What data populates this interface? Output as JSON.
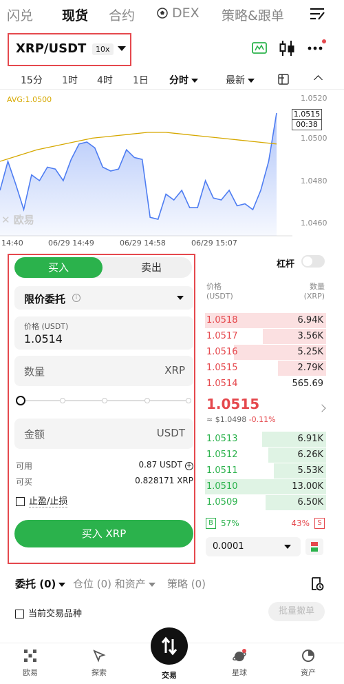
{
  "topnav": {
    "items": [
      "闪兑",
      "现货",
      "合约",
      "DEX",
      "策略&跟单"
    ],
    "active_index": 1
  },
  "pair": {
    "name": "XRP/USDT",
    "leverage": "10x"
  },
  "intervals": {
    "items": [
      "15分",
      "1时",
      "4时",
      "1日"
    ],
    "mode": "分时",
    "sort": "最新"
  },
  "chart": {
    "avg_label": "AVG:1.0500",
    "current_price": "1.0515",
    "countdown": "00:38",
    "watermark": "欧易"
  },
  "chart_data": {
    "type": "line",
    "x_labels": [
      "14:40",
      "06/29 14:49",
      "06/29 14:58",
      "06/29 15:07"
    ],
    "y_ticks": [
      "1.0520",
      "1.0500",
      "1.0480",
      "1.0460"
    ],
    "ylim": [
      1.0455,
      1.0525
    ],
    "series": [
      {
        "values": [
          1.0475,
          1.049,
          1.0478,
          1.0465,
          1.0483,
          1.048,
          1.0487,
          1.0486,
          1.048,
          1.0491,
          1.0499,
          1.05,
          1.0497,
          1.0487,
          1.0485,
          1.0486,
          1.0496,
          1.0492,
          1.0491,
          1.0461,
          1.046,
          1.0473,
          1.047,
          1.0475,
          1.0466,
          1.0466,
          1.048,
          1.0471,
          1.047,
          1.0475,
          1.0467,
          1.0468,
          1.0465,
          1.0475,
          1.049,
          1.0515
        ]
      },
      {
        "values": [
          1.049,
          1.0493,
          1.0496,
          1.0498,
          1.05,
          1.0502,
          1.0503,
          1.0504,
          1.0505,
          1.0505,
          1.0504,
          1.0503,
          1.0502,
          1.0501,
          1.05,
          1.0499
        ]
      }
    ]
  },
  "trade": {
    "tab_buy": "买入",
    "tab_sell": "卖出",
    "order_type": "限价委托",
    "price_caption": "价格 (USDT)",
    "price_value": "1.0514",
    "qty_placeholder": "数量",
    "qty_unit": "XRP",
    "amount_placeholder": "金额",
    "amount_unit": "USDT",
    "available_label": "可用",
    "available_value": "0.87 USDT",
    "can_buy_label": "可买",
    "can_buy_value": "0.828171 XRP",
    "tpsl_label": "止盈/止损",
    "buy_button": "买入 XRP"
  },
  "orderbook": {
    "leverage_label": "杠杆",
    "price_header": "价格",
    "price_header_unit": "(USDT)",
    "qty_header": "数量",
    "qty_header_unit": "(XRP)",
    "asks": [
      {
        "price": "1.0518",
        "qty": "6.94K",
        "depth": 1.0
      },
      {
        "price": "1.0517",
        "qty": "3.56K",
        "depth": 0.52
      },
      {
        "price": "1.0516",
        "qty": "5.25K",
        "depth": 0.76
      },
      {
        "price": "1.0515",
        "qty": "2.79K",
        "depth": 0.4
      },
      {
        "price": "1.0514",
        "qty": "565.69",
        "depth": 0.0
      }
    ],
    "last_price": "1.0515",
    "last_usd": "≈ $1.0498",
    "last_change": "-0.11%",
    "bids": [
      {
        "price": "1.0513",
        "qty": "6.91K",
        "depth": 0.53
      },
      {
        "price": "1.0512",
        "qty": "6.26K",
        "depth": 0.48
      },
      {
        "price": "1.0511",
        "qty": "5.53K",
        "depth": 0.43
      },
      {
        "price": "1.0510",
        "qty": "13.00K",
        "depth": 1.0
      },
      {
        "price": "1.0509",
        "qty": "6.50K",
        "depth": 0.5
      }
    ],
    "buy_pct": "57%",
    "sell_pct": "43%",
    "buy_letter": "B",
    "sell_letter": "S",
    "depth_value": "0.0001"
  },
  "orders": {
    "tabs": [
      "委托 (0)",
      "仓位 (0) 和资产",
      "策略 (0)"
    ],
    "current_pair_label": "当前交易品种",
    "cancel_all": "批量撤单"
  },
  "bottomnav": {
    "items": [
      "欧易",
      "探索",
      "交易",
      "星球",
      "资产"
    ]
  },
  "colors": {
    "buy": "#2bb24c",
    "sell": "#e5484d",
    "avg": "#d6a800",
    "line": "#4e7df2"
  }
}
